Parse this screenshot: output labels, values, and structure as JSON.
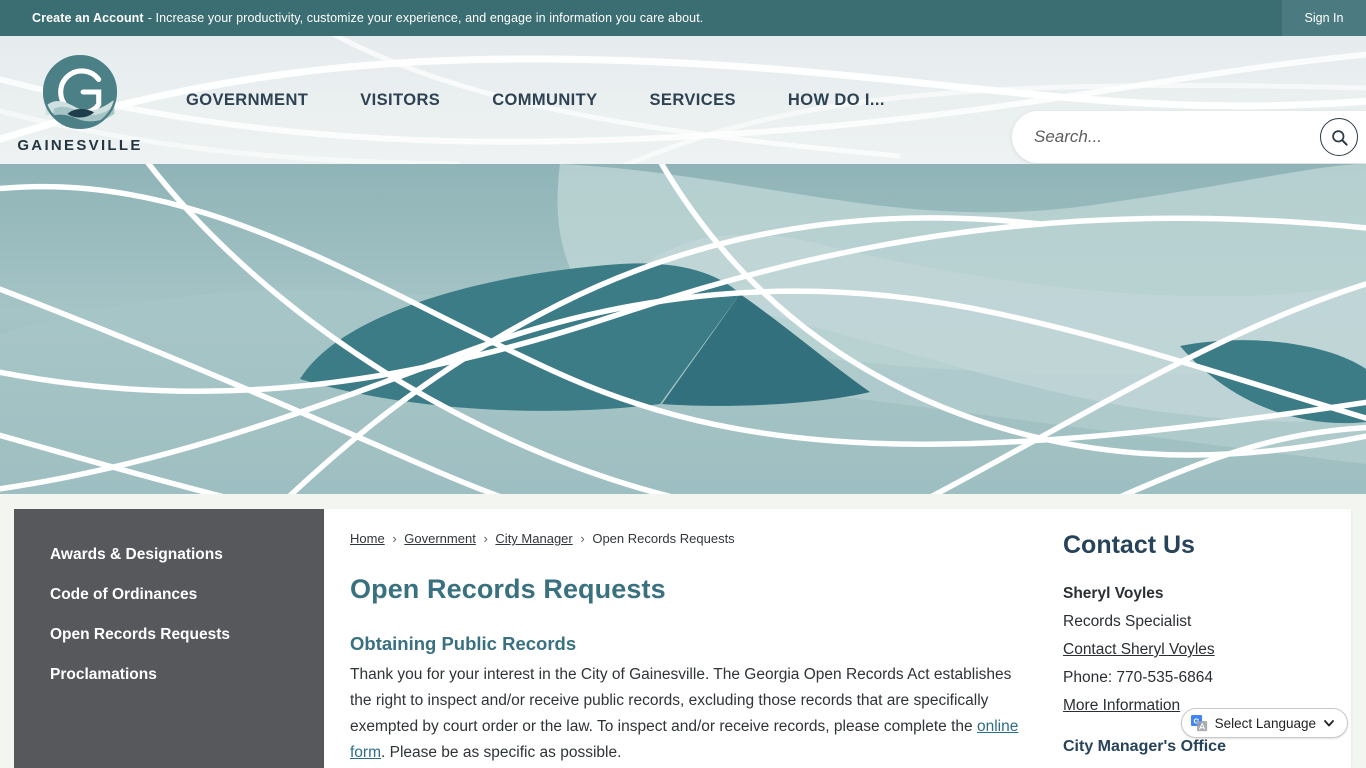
{
  "topbar": {
    "account_link": "Create an Account",
    "message": "- Increase your productivity, customize your experience, and engage in information you care about.",
    "sign_in": "Sign In"
  },
  "header": {
    "logo_word": "GAINESVILLE",
    "logo_icon": "gainesville-circular-g-logo",
    "nav": [
      {
        "label": "GOVERNMENT"
      },
      {
        "label": "VISITORS"
      },
      {
        "label": "COMMUNITY"
      },
      {
        "label": "SERVICES"
      },
      {
        "label": "HOW DO I..."
      }
    ],
    "search": {
      "placeholder": "Search...",
      "value": "",
      "icon": "search-icon"
    }
  },
  "sidebar": {
    "items": [
      {
        "label": "Awards & Designations"
      },
      {
        "label": "Code of Ordinances"
      },
      {
        "label": "Open Records Requests"
      },
      {
        "label": "Proclamations"
      }
    ]
  },
  "breadcrumb": {
    "items": [
      {
        "label": "Home",
        "link": true
      },
      {
        "label": "Government",
        "link": true
      },
      {
        "label": "City Manager",
        "link": true
      },
      {
        "label": "Open Records Requests",
        "link": false
      }
    ],
    "separator": "›"
  },
  "main": {
    "title": "Open Records Requests",
    "section_heading": "Obtaining Public Records",
    "paragraph_part1": "Thank you for your interest in the City of Gainesville. The Georgia Open Records Act establishes the right to inspect and/or receive public records, excluding those records that are specifically exempted by court order or the law. To inspect and/or receive records, please complete the ",
    "paragraph_link": "online form",
    "paragraph_part2": ". Please be as specific as possible."
  },
  "contact": {
    "title": "Contact Us",
    "name": "Sheryl Voyles",
    "role": "Records Specialist",
    "contact_link": "Contact Sheryl Voyles",
    "phone": "Phone: 770-535-6864",
    "more_info": "More Information",
    "office": "City Manager's Office"
  },
  "translate": {
    "label": "Select Language",
    "badge_icon": "google-translate-icon",
    "chevron_icon": "chevron-down-icon"
  },
  "colors": {
    "topbar_bg": "#3b6e72",
    "signin_bg": "#4b7b80",
    "header_bg": "#eaeff0",
    "nav_text": "#2e4253",
    "banner_base": "#9dc0c2",
    "banner_dark": "#3c7c86",
    "banner_light": "#bcd3d4",
    "sidebar_bg": "#56585c",
    "heading_teal": "#3a7180",
    "contact_heading": "#26435a",
    "page_bg": "#f3f6f0"
  }
}
